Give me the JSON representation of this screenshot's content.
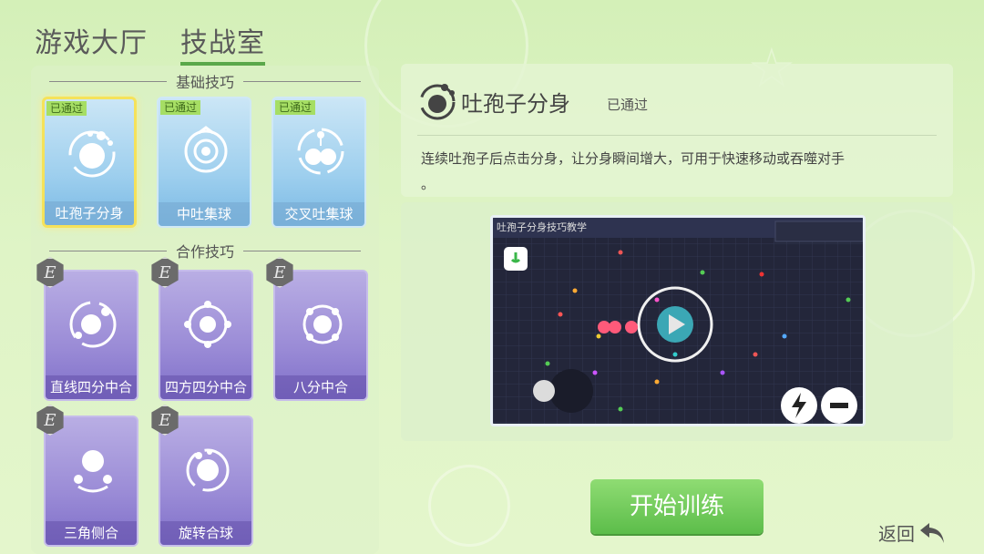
{
  "tabs": [
    {
      "label": "游戏大厅",
      "active": false
    },
    {
      "label": "技战室",
      "active": true
    }
  ],
  "sections": {
    "basic": "基础技巧",
    "coop": "合作技巧"
  },
  "basic_cards": [
    {
      "label": "吐孢子分身",
      "badge": "已通过",
      "selected": true
    },
    {
      "label": "中吐集球",
      "badge": "已通过",
      "selected": false
    },
    {
      "label": "交叉吐集球",
      "badge": "已通过",
      "selected": false
    }
  ],
  "coop_cards": [
    {
      "label": "直线四分中合",
      "badge": "E"
    },
    {
      "label": "四方四分中合",
      "badge": "E"
    },
    {
      "label": "八分中合",
      "badge": "E"
    },
    {
      "label": "三角侧合",
      "badge": "E"
    },
    {
      "label": "旋转合球",
      "badge": "E"
    }
  ],
  "detail": {
    "title": "吐孢子分身",
    "status": "已通过",
    "description": "连续吐孢子后点击分身，让分身瞬间增大，可用于快速移动或吞噬对手",
    "description_tail": "。",
    "video_title": "吐孢子分身技巧教学",
    "video_icons": [
      "mic-icon",
      "play-icon",
      "lightning-icon",
      "minus-icon"
    ]
  },
  "buttons": {
    "start": "开始训练",
    "back": "返回"
  },
  "colors": {
    "start_button": "#5cbd4a",
    "passed_badge": "#a6de64",
    "selected_border": "#f5e25a"
  }
}
